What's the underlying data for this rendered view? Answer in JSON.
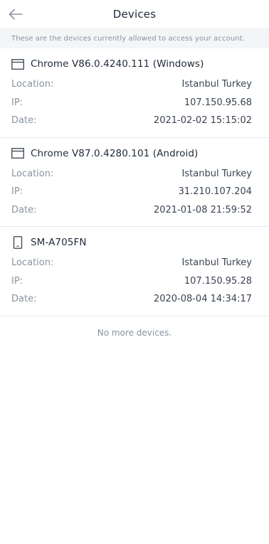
{
  "header": {
    "title": "Devices"
  },
  "notice": "These are the devices currently allowed to access your account.",
  "labels": {
    "location": "Location:",
    "ip": "IP:",
    "date": "Date:"
  },
  "devices": [
    {
      "name": "Chrome V86.0.4240.111 (Windows)",
      "icon": "browser-window-icon",
      "location": "Istanbul Turkey",
      "ip": "107.150.95.68",
      "date": "2021-02-02 15:15:02"
    },
    {
      "name": "Chrome V87.0.4280.101 (Android)",
      "icon": "browser-window-icon",
      "location": "Istanbul Turkey",
      "ip": "31.210.107.204",
      "date": "2021-01-08 21:59:52"
    },
    {
      "name": "SM-A705FN",
      "icon": "phone-icon",
      "location": "Istanbul Turkey",
      "ip": "107.150.95.28",
      "date": "2020-08-04 14:34:17"
    }
  ],
  "footer": "No more devices."
}
